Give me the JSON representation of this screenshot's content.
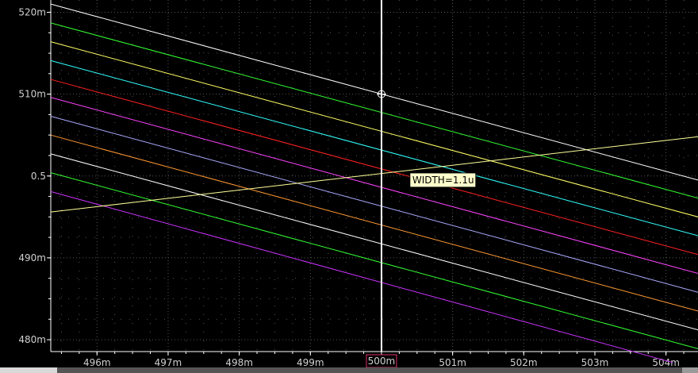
{
  "chart_data": {
    "type": "line",
    "title": "",
    "xlabel": "",
    "ylabel": "",
    "xlim": [
      495.35,
      504.45
    ],
    "ylim": [
      0.47855,
      0.5215
    ],
    "grid": true,
    "x_ticks": [
      {
        "value": 496,
        "label": "496m"
      },
      {
        "value": 497,
        "label": "497m"
      },
      {
        "value": 498,
        "label": "498m"
      },
      {
        "value": 499,
        "label": "499m"
      },
      {
        "value": 500,
        "label": "500m"
      },
      {
        "value": 501,
        "label": "501m"
      },
      {
        "value": 502,
        "label": "502m"
      },
      {
        "value": 503,
        "label": "503m"
      },
      {
        "value": 504,
        "label": "504m"
      }
    ],
    "y_ticks": [
      {
        "value": 0.48,
        "label": "480m"
      },
      {
        "value": 0.49,
        "label": "490m"
      },
      {
        "value": 0.5,
        "label": "0.5"
      },
      {
        "value": 0.51,
        "label": "510m"
      },
      {
        "value": 0.52,
        "label": "520m"
      }
    ],
    "series": [
      {
        "color": "#ffffff",
        "x": [
          495.35,
          504.45
        ],
        "y": [
          0.521,
          0.4995
        ]
      },
      {
        "color": "#33ff33",
        "x": [
          495.35,
          504.45
        ],
        "y": [
          0.5187,
          0.4973
        ]
      },
      {
        "color": "#ffff66",
        "x": [
          495.35,
          504.45
        ],
        "y": [
          0.5164,
          0.495
        ]
      },
      {
        "color": "#33ffff",
        "x": [
          495.35,
          504.45
        ],
        "y": [
          0.5141,
          0.4927
        ]
      },
      {
        "color": "#ff2222",
        "x": [
          495.35,
          504.45
        ],
        "y": [
          0.5118,
          0.4904
        ]
      },
      {
        "color": "#ff44ff",
        "x": [
          495.35,
          504.45
        ],
        "y": [
          0.5096,
          0.4881
        ]
      },
      {
        "color": "#aaaaff",
        "x": [
          495.35,
          504.45
        ],
        "y": [
          0.5073,
          0.4858
        ]
      },
      {
        "color": "#ff9933",
        "x": [
          495.35,
          504.45
        ],
        "y": [
          0.505,
          0.4835
        ]
      },
      {
        "color": "#ffffff",
        "x": [
          495.35,
          504.45
        ],
        "y": [
          0.5027,
          0.4812
        ]
      },
      {
        "color": "#33ff33",
        "x": [
          495.35,
          504.45
        ],
        "y": [
          0.5004,
          0.4789
        ]
      },
      {
        "color": "#cc33ff",
        "x": [
          495.35,
          504.1
        ],
        "y": [
          0.4981,
          0.4772
        ]
      },
      {
        "color": "#ffff99",
        "x": [
          495.35,
          504.45
        ],
        "y": [
          0.4956,
          0.5048
        ]
      }
    ],
    "cursor": {
      "x": 500,
      "label": "500m",
      "marker_y": 0.51
    },
    "annotation": {
      "text": "WIDTH=1.1u",
      "x": 500.4,
      "y": 0.4995
    }
  }
}
